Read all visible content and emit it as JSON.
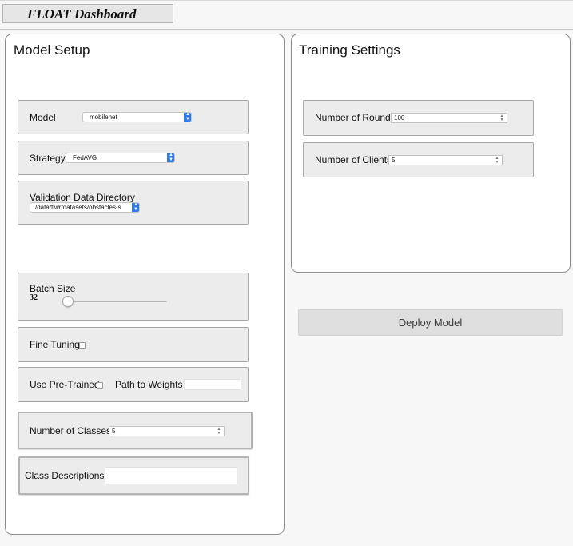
{
  "header": {
    "title": "FLOAT Dashboard"
  },
  "model_setup": {
    "title": "Model Setup",
    "model": {
      "label": "Model",
      "value": "mobilenet"
    },
    "strategy": {
      "label": "Strategy",
      "value": "FedAVG"
    },
    "validation": {
      "label": "Validation Data Directory",
      "value": "/data/flwr/datasets/obstacles-s"
    },
    "batch_size": {
      "label": "Batch Size",
      "value": "32",
      "level_fraction": 0.06
    },
    "fine_tuning": {
      "label": "Fine Tuning",
      "checked": false
    },
    "pretrained": {
      "label": "Use Pre-Trained",
      "checked": false,
      "weights_label": "Path to Weights",
      "weights_value": ""
    },
    "num_classes": {
      "label": "Number of Classes",
      "value": "5"
    },
    "class_desc": {
      "label": "Class Descriptions",
      "value": ""
    }
  },
  "training_settings": {
    "title": "Training Settings",
    "rounds": {
      "label": "Number of Rounds",
      "value": "100"
    },
    "clients": {
      "label": "Number of Clients",
      "value": "5"
    }
  },
  "deploy": {
    "label": "Deploy Model"
  },
  "colors": {
    "accent": "#2f7be6",
    "panel_border": "#8c8c8c",
    "group_bg": "#ececec"
  }
}
